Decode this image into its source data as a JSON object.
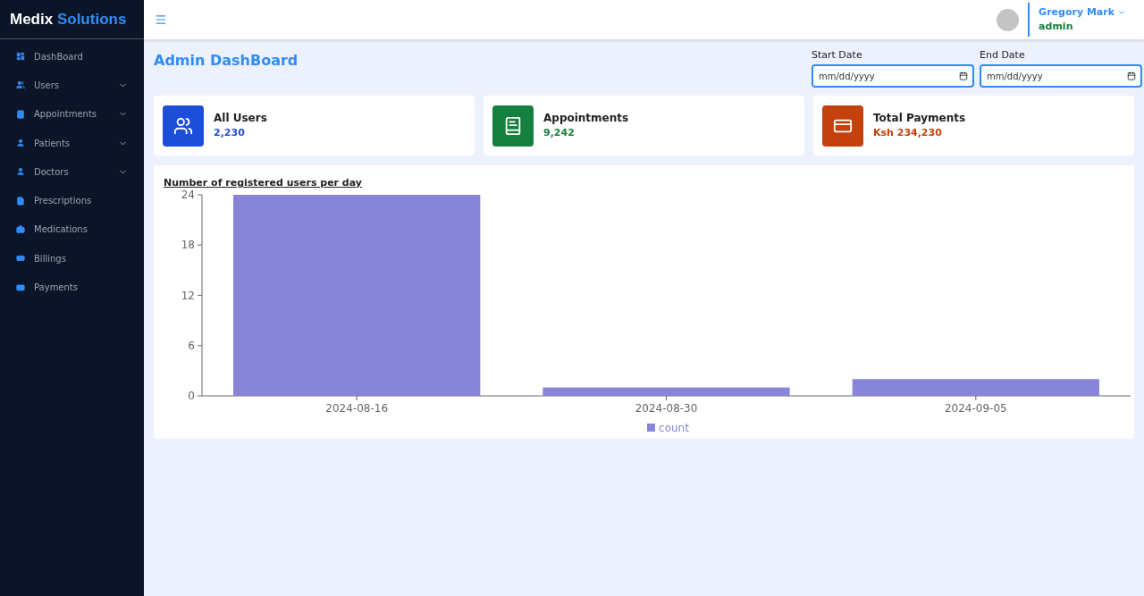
{
  "brand": {
    "name": "Medix",
    "accent": "Solutions"
  },
  "sidebar": {
    "items": [
      {
        "label": "DashBoard",
        "kind": "dashboard",
        "expandable": false
      },
      {
        "label": "Users",
        "kind": "users",
        "expandable": true
      },
      {
        "label": "Appointments",
        "kind": "book",
        "expandable": true
      },
      {
        "label": "Patients",
        "kind": "person",
        "expandable": true
      },
      {
        "label": "Doctors",
        "kind": "person",
        "expandable": true
      },
      {
        "label": "Prescriptions",
        "kind": "prescription",
        "expandable": false
      },
      {
        "label": "Medications",
        "kind": "medication",
        "expandable": false
      },
      {
        "label": "Billings",
        "kind": "money",
        "expandable": false
      },
      {
        "label": "Payments",
        "kind": "card",
        "expandable": false
      }
    ]
  },
  "user": {
    "name": "Gregory Mark",
    "role": "admin"
  },
  "page_title": "Admin DashBoard",
  "date_filters": [
    {
      "label": "Start Date",
      "placeholder": "mm/dd/yyyy"
    },
    {
      "label": "End Date",
      "placeholder": "mm/dd/yyyy"
    }
  ],
  "stats": [
    {
      "kind": "users",
      "title": "All Users",
      "value": "2,230",
      "color": "#1d4ed8"
    },
    {
      "kind": "book",
      "title": "Appointments",
      "value": "9,242",
      "color": "#15803d"
    },
    {
      "kind": "card",
      "title": "Total Payments",
      "value": "Ksh 234,230",
      "color": "#c2410c"
    }
  ],
  "chart": {
    "title": "Number of registered users per day",
    "chart_data": {
      "type": "bar",
      "categories": [
        "2024-08-16",
        "2024-08-30",
        "2024-09-05"
      ],
      "series": [
        {
          "name": "count",
          "color": "#8884d8",
          "values": [
            24,
            1,
            2
          ]
        }
      ],
      "ylim": [
        0,
        24
      ],
      "yticks": [
        0,
        6,
        12,
        18,
        24
      ]
    }
  }
}
